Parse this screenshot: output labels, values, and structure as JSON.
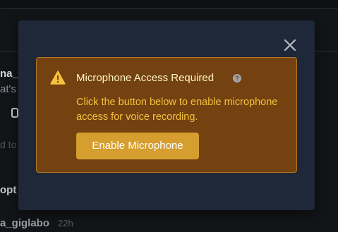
{
  "background": {
    "item1_name": "na_",
    "item1_snippet": "at's",
    "item2_snippet": "d to",
    "item3_name": "opt",
    "item4_name": "a_giglabo",
    "item4_time": "22h"
  },
  "modal": {
    "close_icon": "close-icon",
    "alert": {
      "icon": "warning-triangle-icon",
      "title": "Microphone Access Required",
      "help_icon": "help-circle-icon",
      "help_glyph": "?",
      "body": "Click the button below to enable microphone access for voice recording.",
      "button_label": "Enable Microphone"
    }
  },
  "colors": {
    "page_bg": "#121417",
    "modal_bg": "#1e2838",
    "alert_bg": "#744210",
    "alert_border": "#b7791f",
    "alert_title": "#fef3c7",
    "alert_body": "#f6c23e",
    "button_bg": "#d69e2e",
    "button_text": "#ffffff",
    "warning_icon": "#f6c23e"
  }
}
